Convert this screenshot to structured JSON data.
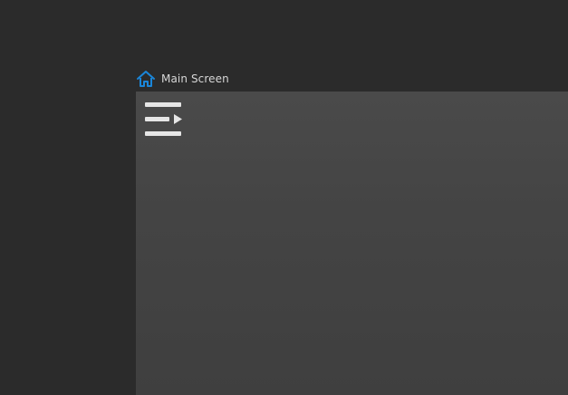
{
  "breadcrumb": {
    "home_icon": "home-icon",
    "label": "Main Screen"
  },
  "content": {
    "menu_icon": "playlist-menu-icon"
  },
  "colors": {
    "background": "#2b2b2b",
    "panel": "#484848",
    "accent": "#1a86d9",
    "text": "#d7d7d7",
    "icon": "#e6e6e6"
  }
}
